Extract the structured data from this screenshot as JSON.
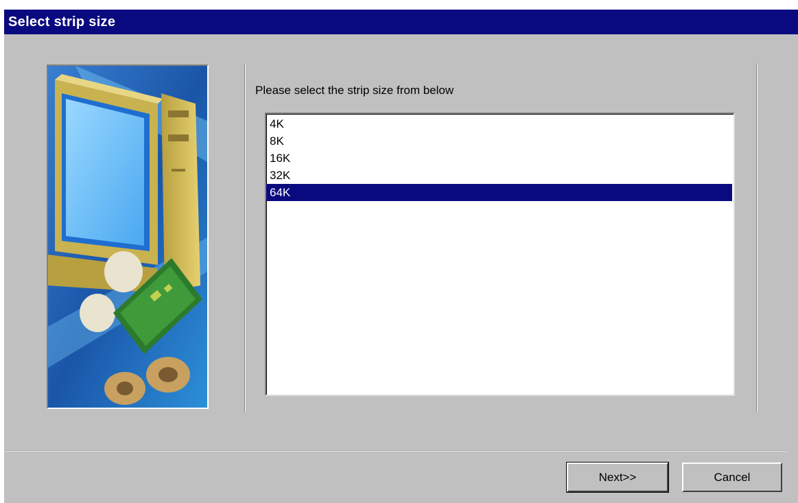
{
  "window": {
    "title": "Select strip size"
  },
  "prompt": "Please select the strip size from below",
  "strip_sizes": [
    {
      "label": "4K",
      "selected": false
    },
    {
      "label": "8K",
      "selected": false
    },
    {
      "label": "16K",
      "selected": false
    },
    {
      "label": "32K",
      "selected": false
    },
    {
      "label": "64K",
      "selected": true
    }
  ],
  "buttons": {
    "next": "Next>>",
    "cancel": "Cancel"
  },
  "colors": {
    "titlebar": "#0a0a80",
    "dialog_bg": "#c0c0c0",
    "selection": "#0a0a80"
  },
  "wizard_image": {
    "icon": "computer-hardware-illustration"
  }
}
